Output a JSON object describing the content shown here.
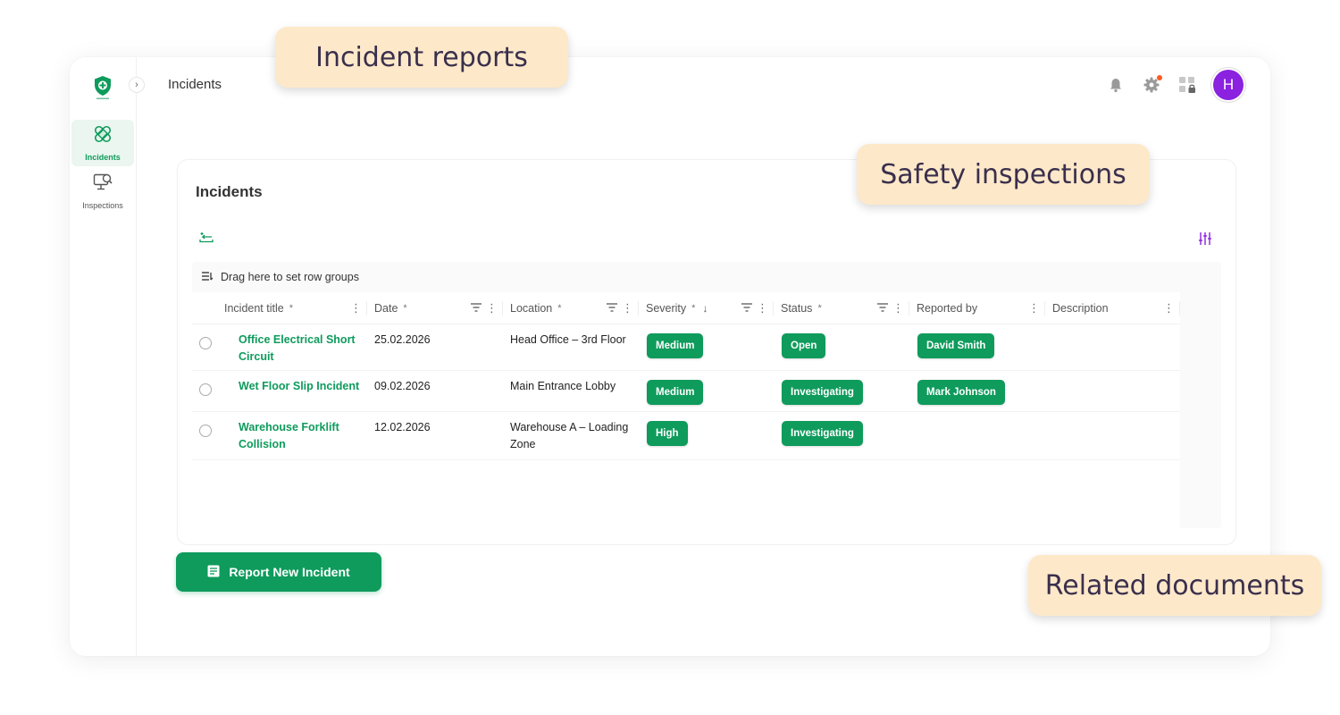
{
  "header": {
    "page_title": "Incidents",
    "avatar_initial": "H"
  },
  "sidebar": {
    "items": [
      {
        "label": "Incidents",
        "icon": "bandage-icon",
        "active": true
      },
      {
        "label": "Inspections",
        "icon": "monitor-search-icon",
        "active": false
      }
    ]
  },
  "card": {
    "title": "Incidents"
  },
  "grid": {
    "group_panel_text": "Drag here to set row groups",
    "columns": [
      "Incident title",
      "Date",
      "Location",
      "Severity",
      "Status",
      "Reported by",
      "Description"
    ],
    "rows": [
      {
        "title": "Office Electrical Short Circuit",
        "date": "25.02.2026",
        "location": "Head Office – 3rd Floor",
        "severity": "Medium",
        "status": "Open",
        "reported_by": "David Smith",
        "description": ""
      },
      {
        "title": "Wet Floor Slip Incident",
        "date": "09.02.2026",
        "location": "Main Entrance Lobby",
        "severity": "Medium",
        "status": "Investigating",
        "reported_by": "Mark Johnson",
        "description": ""
      },
      {
        "title": "Warehouse Forklift Collision",
        "date": "12.02.2026",
        "location": "Warehouse A – Loading Zone",
        "severity": "High",
        "status": "Investigating",
        "reported_by": "",
        "description": ""
      }
    ]
  },
  "actions": {
    "report_button": "Report New Incident"
  },
  "callouts": {
    "incident_reports": "Incident reports",
    "safety_inspections": "Safety inspections",
    "related_documents": "Related documents"
  },
  "colors": {
    "brand_green": "#0e9b5c",
    "avatar": "#8a22e0",
    "callout_bg": "#fde9c9",
    "notification_dot": "#ff5a1f",
    "filter_icon": "#8a22e0"
  }
}
